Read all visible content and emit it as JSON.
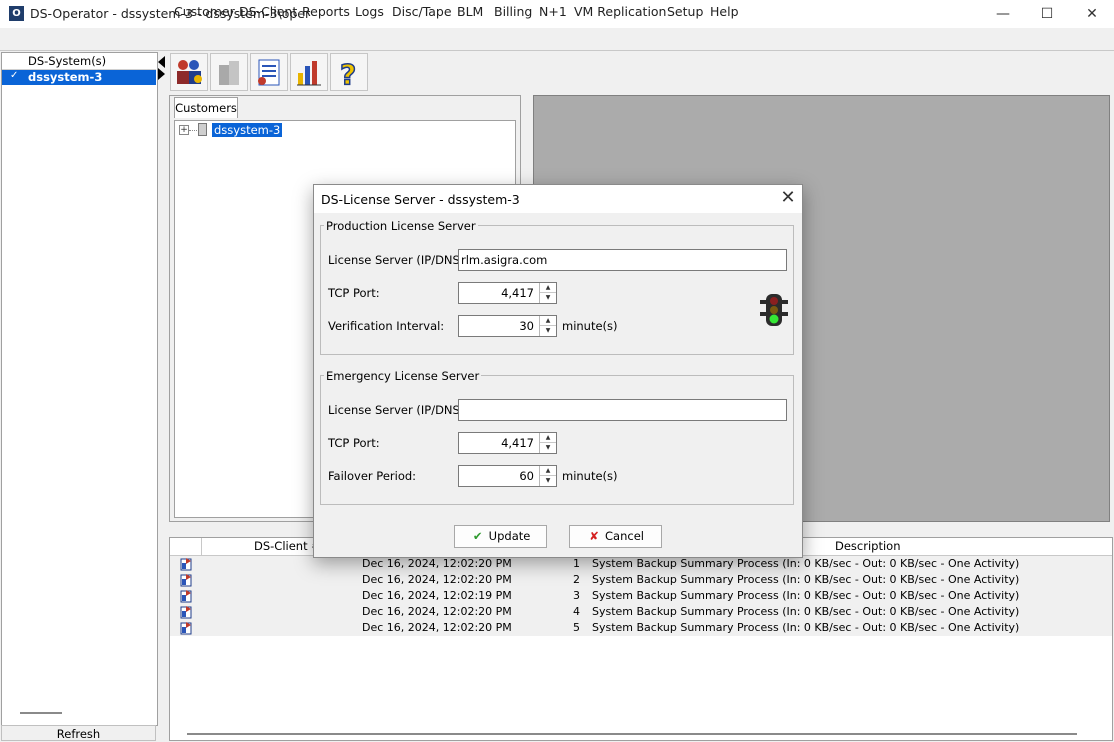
{
  "window": {
    "app_icon_letter": "O",
    "title": "DS-Operator - dssystem-3 - dssystem-3\\oper",
    "controls": {
      "minimize": "—",
      "maximize": "☐",
      "close": "✕"
    }
  },
  "menu": [
    "Customer",
    "DS-Client",
    "Reports",
    "Logs",
    "Disc/Tape",
    "BLM",
    "Billing",
    "N+1",
    "VM Replication",
    "Setup",
    "Help"
  ],
  "left_pane": {
    "header": "DS-System(s)",
    "selected_item": "dssystem-3",
    "refresh_label": "Refresh"
  },
  "toolbar": [
    "customers-icon",
    "disabled-icon",
    "report-icon",
    "stats-icon",
    "help-icon"
  ],
  "customers": {
    "tab_label": "Customers",
    "tree_root": "dssystem-3"
  },
  "grid": {
    "columns": [
      "DS-Client #",
      "Description"
    ],
    "rows": [
      {
        "datetime": "Dec 16, 2024, 12:02:20 PM",
        "num": "1",
        "desc": "System Backup Summary Process  (In: 0 KB/sec - Out: 0 KB/sec - One Activity)"
      },
      {
        "datetime": "Dec 16, 2024, 12:02:20 PM",
        "num": "2",
        "desc": "System Backup Summary Process  (In: 0 KB/sec - Out: 0 KB/sec - One Activity)"
      },
      {
        "datetime": "Dec 16, 2024, 12:02:19 PM",
        "num": "3",
        "desc": "System Backup Summary Process  (In: 0 KB/sec - Out: 0 KB/sec - One Activity)"
      },
      {
        "datetime": "Dec 16, 2024, 12:02:20 PM",
        "num": "4",
        "desc": "System Backup Summary Process  (In: 0 KB/sec - Out: 0 KB/sec - One Activity)"
      },
      {
        "datetime": "Dec 16, 2024, 12:02:20 PM",
        "num": "5",
        "desc": "System Backup Summary Process  (In: 0 KB/sec - Out: 0 KB/sec - One Activity)"
      }
    ]
  },
  "dialog": {
    "title": "DS-License Server - dssystem-3",
    "production": {
      "group_title": "Production License Server",
      "server_label": "License Server (IP/DNS):",
      "server_value": "rlm.asigra.com",
      "port_label": "TCP Port:",
      "port_value": "4,417",
      "interval_label": "Verification Interval:",
      "interval_value": "30",
      "interval_unit": "minute(s)"
    },
    "emergency": {
      "group_title": "Emergency License Server",
      "server_label": "License Server (IP/DNS):",
      "server_value": "",
      "port_label": "TCP Port:",
      "port_value": "4,417",
      "failover_label": "Failover Period:",
      "failover_value": "60",
      "failover_unit": "minute(s)"
    },
    "update_label": "Update",
    "cancel_label": "Cancel",
    "status_icon": "traffic-light-icon"
  }
}
